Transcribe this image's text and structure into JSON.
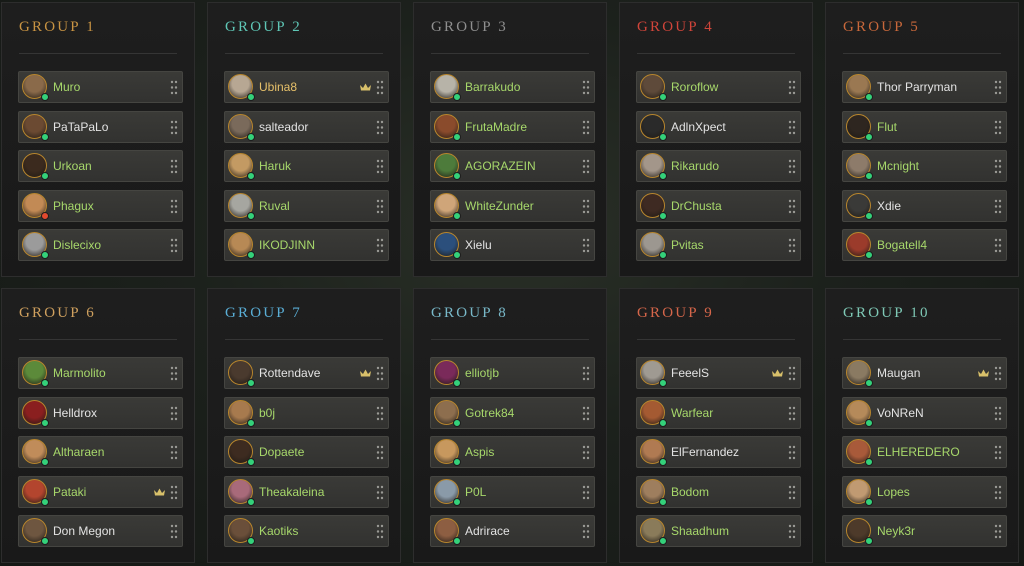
{
  "colors": {
    "online": "#34d17a",
    "away": "#e24a2f",
    "name_green": "#a7d86b",
    "name_white": "#e3e3e3",
    "name_gold": "#e7c16a",
    "crown": "#d8c06a"
  },
  "groups": [
    {
      "title": "GROUP 1",
      "color": "#c99443",
      "players": [
        {
          "name": "Muro",
          "status": "online",
          "avatar": "#8a6a4a"
        },
        {
          "name": "PaTaPaLo",
          "status": "online",
          "avatar": "#6b4a32",
          "white": true
        },
        {
          "name": "Urkoan",
          "status": "online",
          "avatar": "#3b2a1e"
        },
        {
          "name": "Phagux",
          "status": "away",
          "avatar": "#c28a55"
        },
        {
          "name": "Dislecixo",
          "status": "online",
          "avatar": "#9b9b9b"
        }
      ]
    },
    {
      "title": "GROUP 2",
      "color": "#5fc7b6",
      "players": [
        {
          "name": "Ubina8",
          "status": "online",
          "avatar": "#b7a793",
          "gold": true,
          "leader": true
        },
        {
          "name": "salteador",
          "status": "online",
          "avatar": "#7a6a5b",
          "white": true
        },
        {
          "name": "Haruk",
          "status": "online",
          "avatar": "#c39a63"
        },
        {
          "name": "Ruval",
          "status": "online",
          "avatar": "#a6a6a0"
        },
        {
          "name": "IKODJINN",
          "status": "online",
          "avatar": "#b78955"
        }
      ]
    },
    {
      "title": "GROUP 3",
      "color": "#8f8f8f",
      "players": [
        {
          "name": "Barrakudo",
          "status": "online",
          "avatar": "#b7b3a8"
        },
        {
          "name": "FrutaMadre",
          "status": "online",
          "avatar": "#8a4b2c"
        },
        {
          "name": "AGORAZEIN",
          "status": "online",
          "avatar": "#4d7b3b"
        },
        {
          "name": "WhiteZunder",
          "status": "online",
          "avatar": "#cfa579"
        },
        {
          "name": "Xielu",
          "status": "online",
          "avatar": "#2b4f7c",
          "white": true
        }
      ]
    },
    {
      "title": "GROUP 4",
      "color": "#d1453a",
      "players": [
        {
          "name": "Roroflow",
          "status": "online",
          "avatar": "#5e4a3a"
        },
        {
          "name": "AdlnXpect",
          "status": "online",
          "avatar": "#2a2a2a",
          "white": true
        },
        {
          "name": "Rikarudo",
          "status": "online",
          "avatar": "#a3968a"
        },
        {
          "name": "DrChusta",
          "status": "online",
          "avatar": "#3e2a22"
        },
        {
          "name": "Pvitas",
          "status": "online",
          "avatar": "#9c9790"
        }
      ]
    },
    {
      "title": "GROUP 5",
      "color": "#c8683b",
      "players": [
        {
          "name": "Thor Parryman",
          "status": "online",
          "avatar": "#9a7852",
          "white": true
        },
        {
          "name": "Flut",
          "status": "online",
          "avatar": "#2e2620"
        },
        {
          "name": "Mcnight",
          "status": "online",
          "avatar": "#8d7b6a"
        },
        {
          "name": "Xdie",
          "status": "online",
          "avatar": "#3a3a38",
          "white": true
        },
        {
          "name": "Bogatell4",
          "status": "online",
          "avatar": "#9b3b2b"
        }
      ]
    },
    {
      "title": "GROUP 6",
      "color": "#d0a15f",
      "players": [
        {
          "name": "Marmolito",
          "status": "online",
          "avatar": "#5c8a3a"
        },
        {
          "name": "Helldrox",
          "status": "online",
          "avatar": "#8a1f1f",
          "white": true
        },
        {
          "name": "Altharaen",
          "status": "online",
          "avatar": "#c08c5a"
        },
        {
          "name": "Pataki",
          "status": "online",
          "avatar": "#b3452e",
          "leader": true
        },
        {
          "name": "Don Megon",
          "status": "online",
          "avatar": "#6e5640",
          "white": true
        }
      ]
    },
    {
      "title": "GROUP 7",
      "color": "#5aaed6",
      "players": [
        {
          "name": "Rottendave",
          "status": "online",
          "avatar": "#4a3a2e",
          "white": true,
          "leader": true
        },
        {
          "name": "b0j",
          "status": "online",
          "avatar": "#a77a4e"
        },
        {
          "name": "Dopaete",
          "status": "online",
          "avatar": "#3d2b20"
        },
        {
          "name": "Theakaleina",
          "status": "online",
          "avatar": "#a86a7a"
        },
        {
          "name": "Kaotiks",
          "status": "online",
          "avatar": "#6a4f3a"
        }
      ]
    },
    {
      "title": "GROUP 8",
      "color": "#79b9c9",
      "players": [
        {
          "name": "elliotjb",
          "status": "online",
          "avatar": "#7a2a5a"
        },
        {
          "name": "Gotrek84",
          "status": "online",
          "avatar": "#8d6e4e"
        },
        {
          "name": "Aspis",
          "status": "online",
          "avatar": "#c7985e"
        },
        {
          "name": "P0L",
          "status": "online",
          "avatar": "#8a9aa8"
        },
        {
          "name": "Adrirace",
          "status": "online",
          "avatar": "#8d5e42",
          "white": true
        }
      ]
    },
    {
      "title": "GROUP 9",
      "color": "#d5664a",
      "players": [
        {
          "name": "FeeelS",
          "status": "online",
          "avatar": "#9f9a92",
          "white": true,
          "leader": true
        },
        {
          "name": "Warfear",
          "status": "online",
          "avatar": "#a45a32"
        },
        {
          "name": "ElFernandez",
          "status": "online",
          "avatar": "#b07a52",
          "white": true
        },
        {
          "name": "Bodom",
          "status": "online",
          "avatar": "#9e7e5e"
        },
        {
          "name": "Shaadhum",
          "status": "online",
          "avatar": "#8a7b5a"
        }
      ]
    },
    {
      "title": "GROUP 10",
      "color": "#7fc9b6",
      "players": [
        {
          "name": "Maugan",
          "status": "online",
          "avatar": "#8a7a62",
          "white": true,
          "leader": true
        },
        {
          "name": "VoNReN",
          "status": "online",
          "avatar": "#b58a5a",
          "white": true
        },
        {
          "name": "ELHEREDERO",
          "status": "online",
          "avatar": "#a85a3a"
        },
        {
          "name": "Lopes",
          "status": "online",
          "avatar": "#c09a72"
        },
        {
          "name": "Neyk3r",
          "status": "online",
          "avatar": "#4d3a2a"
        }
      ]
    }
  ]
}
